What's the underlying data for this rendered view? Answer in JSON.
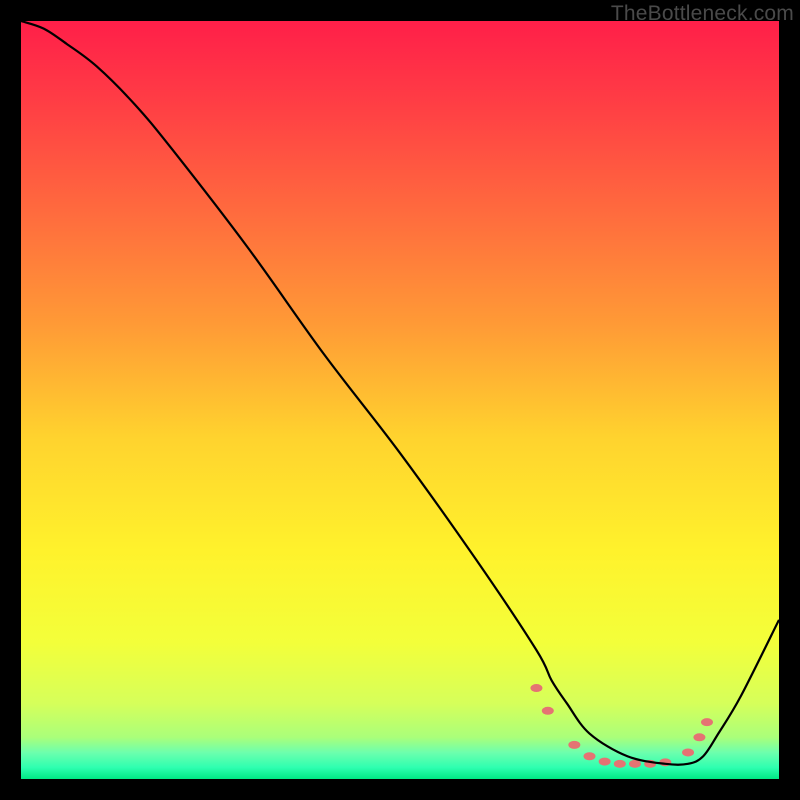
{
  "watermark": "TheBottleneck.com",
  "chart_data": {
    "type": "line",
    "title": "",
    "xlabel": "",
    "ylabel": "",
    "xlim": [
      0,
      100
    ],
    "ylim": [
      0,
      100
    ],
    "grid": false,
    "legend": false,
    "background": {
      "type": "vertical-gradient",
      "stops": [
        {
          "pos": 0.0,
          "color": "#ff1f49"
        },
        {
          "pos": 0.1,
          "color": "#ff3b45"
        },
        {
          "pos": 0.25,
          "color": "#ff6a3e"
        },
        {
          "pos": 0.4,
          "color": "#ff9a36"
        },
        {
          "pos": 0.55,
          "color": "#ffd32e"
        },
        {
          "pos": 0.7,
          "color": "#fff22c"
        },
        {
          "pos": 0.82,
          "color": "#f3ff3a"
        },
        {
          "pos": 0.9,
          "color": "#d6ff5a"
        },
        {
          "pos": 0.945,
          "color": "#aaff7a"
        },
        {
          "pos": 0.965,
          "color": "#6dffad"
        },
        {
          "pos": 0.985,
          "color": "#2effb0"
        },
        {
          "pos": 1.0,
          "color": "#00e884"
        }
      ]
    },
    "series": [
      {
        "name": "bottleneck-curve",
        "color": "#000000",
        "x": [
          0,
          3,
          6,
          10,
          15,
          20,
          30,
          40,
          50,
          60,
          68,
          70,
          72,
          75,
          80,
          85,
          88,
          90,
          92,
          95,
          100
        ],
        "y": [
          100,
          99,
          97,
          94,
          89,
          83,
          70,
          56,
          43,
          29,
          17,
          13,
          10,
          6,
          3,
          2,
          2,
          3,
          6,
          11,
          21
        ]
      }
    ],
    "markers": {
      "name": "highlight-dots",
      "color": "#e57373",
      "points": [
        {
          "x": 68.0,
          "y": 12.0
        },
        {
          "x": 69.5,
          "y": 9.0
        },
        {
          "x": 73.0,
          "y": 4.5
        },
        {
          "x": 75.0,
          "y": 3.0
        },
        {
          "x": 77.0,
          "y": 2.3
        },
        {
          "x": 79.0,
          "y": 2.0
        },
        {
          "x": 81.0,
          "y": 2.0
        },
        {
          "x": 83.0,
          "y": 2.0
        },
        {
          "x": 85.0,
          "y": 2.2
        },
        {
          "x": 88.0,
          "y": 3.5
        },
        {
          "x": 89.5,
          "y": 5.5
        },
        {
          "x": 90.5,
          "y": 7.5
        }
      ],
      "rx": 6,
      "ry": 4
    }
  }
}
